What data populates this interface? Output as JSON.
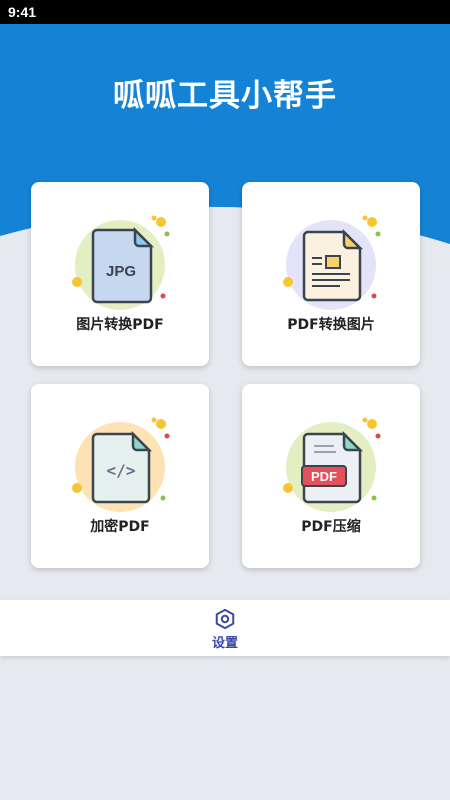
{
  "status_bar": {
    "time": "9:41"
  },
  "header": {
    "title": "呱呱工具小帮手",
    "color": "#1483d6"
  },
  "cards": [
    {
      "label": "图片转换PDF",
      "icon": "jpg-to-pdf-icon",
      "file_badge": "JPG"
    },
    {
      "label": "PDF转换图片",
      "icon": "pdf-to-image-icon"
    },
    {
      "label": "加密PDF",
      "icon": "encrypt-pdf-icon",
      "file_badge": "</>"
    },
    {
      "label": "PDF压缩",
      "icon": "compress-pdf-icon",
      "file_badge": "PDF"
    }
  ],
  "bottom_nav": {
    "settings_label": "设置",
    "settings_icon": "hexagon-gear-icon",
    "accent": "#3a4aa8"
  }
}
